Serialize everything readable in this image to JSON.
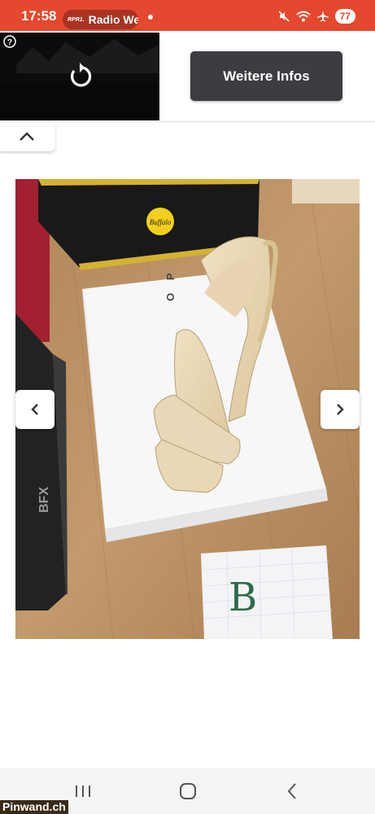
{
  "status_bar": {
    "time": "17:58",
    "radio_logo": "RPR1.",
    "radio_label": "Radio We",
    "battery": "77",
    "icons": [
      "mute-icon",
      "wifi-icon",
      "airplane-icon"
    ]
  },
  "ad": {
    "info_icon": "?",
    "cta_label": "Weitere Infos"
  },
  "listing": {
    "photo_note_letter": "B",
    "box_brand_label": "Buffalo",
    "box_top_letters": "O P",
    "side_box_text": "BFX"
  },
  "watermark": "Pinwand.ch",
  "colors": {
    "status_bar": "#e4482e",
    "cta_button": "#3c3d41",
    "watermark_bg": "#3b2b14"
  }
}
